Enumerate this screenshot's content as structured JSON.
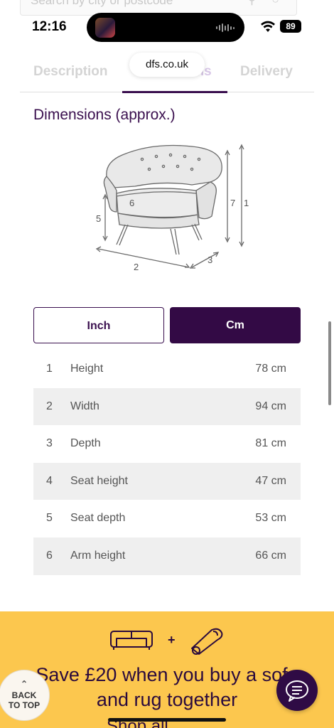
{
  "status_bar": {
    "time": "12:16",
    "battery": "89"
  },
  "search": {
    "placeholder": "Search by city or postcode"
  },
  "browser": {
    "url": "dfs.co.uk"
  },
  "tabs": [
    {
      "label": "Description",
      "active": false
    },
    {
      "label": "Dimensions",
      "active": true
    },
    {
      "label": "Delivery",
      "active": false
    }
  ],
  "section": {
    "title": "Dimensions (approx.)"
  },
  "diagram_labels": [
    "6",
    "5",
    "7",
    "1",
    "2",
    "3"
  ],
  "unit_toggle": {
    "inch_label": "Inch",
    "cm_label": "Cm",
    "selected": "Cm"
  },
  "dimensions": [
    {
      "num": "1",
      "label": "Height",
      "value": "78 cm"
    },
    {
      "num": "2",
      "label": "Width",
      "value": "94 cm"
    },
    {
      "num": "3",
      "label": "Depth",
      "value": "81 cm"
    },
    {
      "num": "4",
      "label": "Seat height",
      "value": "47 cm"
    },
    {
      "num": "5",
      "label": "Seat depth",
      "value": "53 cm"
    },
    {
      "num": "6",
      "label": "Arm height",
      "value": "66 cm"
    }
  ],
  "promo": {
    "line1": "Save £20 when you buy a sofa",
    "line2": "and rug together",
    "more": "Shop all"
  },
  "back_to_top": {
    "line1": "BACK",
    "line2": "TO TOP"
  },
  "colors": {
    "brand_purple": "#3a0f4e",
    "promo_yellow": "#fcc74e"
  }
}
